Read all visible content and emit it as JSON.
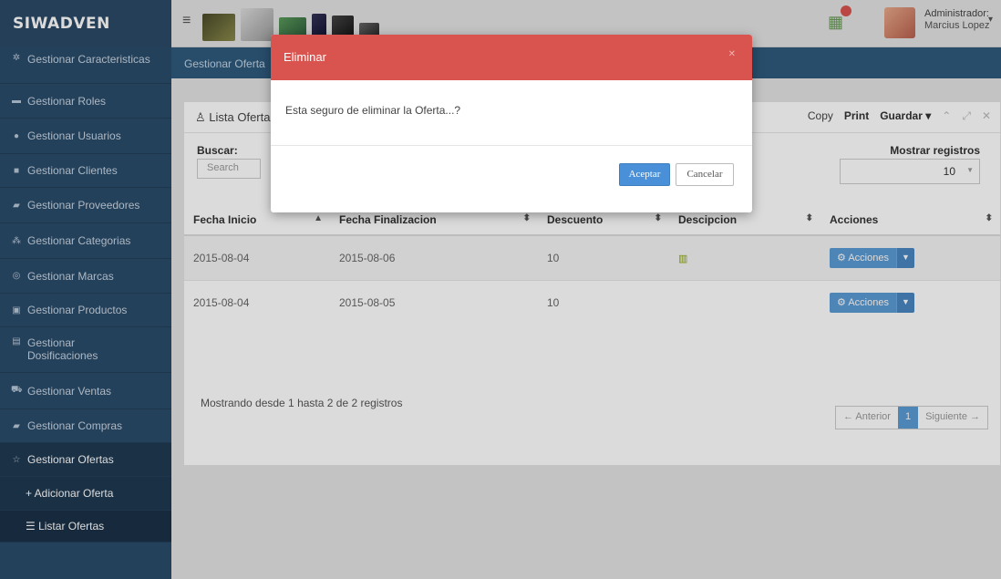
{
  "brand": "SIWADVEN",
  "header": {
    "user_role": "Administrador:",
    "user_name": "Marcius Lopez"
  },
  "sidebar": {
    "items": [
      {
        "label": "Gestionar Caracteristicas",
        "icon": "gears-icon"
      },
      {
        "label": "Gestionar Roles",
        "icon": "card-icon"
      },
      {
        "label": "Gestionar Usuarios",
        "icon": "users-icon"
      },
      {
        "label": "Gestionar Clientes",
        "icon": "briefcase-icon"
      },
      {
        "label": "Gestionar Proveedores",
        "icon": "truck-icon"
      },
      {
        "label": "Gestionar Categorias",
        "icon": "sitemap-icon"
      },
      {
        "label": "Gestionar Marcas",
        "icon": "target-icon"
      },
      {
        "label": "Gestionar Productos",
        "icon": "box-icon"
      },
      {
        "label": "Gestionar Dosificaciones",
        "icon": "document-icon"
      },
      {
        "label": "Gestionar Ventas",
        "icon": "cart-icon"
      },
      {
        "label": "Gestionar Compras",
        "icon": "credit-card-icon"
      },
      {
        "label": "Gestionar Ofertas",
        "icon": "star-icon"
      }
    ],
    "sub_add": "+ Adicionar Oferta",
    "sub_list": "☰ Listar Ofertas"
  },
  "main": {
    "subheader": "Gestionar Oferta",
    "panel_title": "Lista Ofertas",
    "tools": {
      "copy": "Copy",
      "print": "Print",
      "save": "Guardar"
    },
    "search_label": "Buscar:",
    "search_placeholder": "Search",
    "show_label": "Mostrar registros",
    "show_value": "10",
    "columns": [
      "Fecha Inicio",
      "Fecha Finalizacion",
      "Descuento",
      "Descipcion",
      "Acciones"
    ],
    "rows": [
      {
        "start": "2015-08-04",
        "end": "2015-08-06",
        "discount": "10",
        "actions": "Acciones"
      },
      {
        "start": "2015-08-04",
        "end": "2015-08-05",
        "discount": "10",
        "actions": "Acciones"
      }
    ],
    "info": "Mostrando desde 1 hasta 2 de 2 registros",
    "pager": {
      "prev": "← Anterior",
      "page": "1",
      "next": "Siguiente →"
    }
  },
  "modal": {
    "title": "Eliminar",
    "message": "Esta seguro de eliminar la Oferta...?",
    "ok": "Aceptar",
    "cancel": "Cancelar"
  },
  "colors": {
    "sidebar": "#2b4c6a",
    "modal_header": "#d9534f",
    "primary": "#4a90d9"
  }
}
